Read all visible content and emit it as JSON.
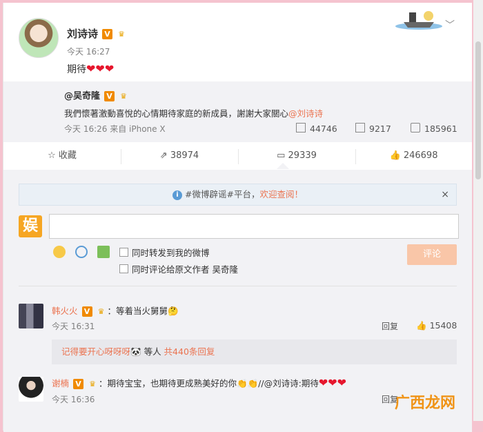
{
  "post": {
    "author": "刘诗诗",
    "verified_badge": "V",
    "time": "今天 16:27",
    "text": "期待",
    "hearts": "❤❤❤"
  },
  "repost": {
    "author": "@吴奇隆",
    "verified_badge": "V",
    "text": "我們懷著激動喜悅的心情期待家庭的新成員，謝謝大家關心",
    "mention": "@刘诗诗",
    "meta": "今天 16:26 来自 iPhone X",
    "forwards": "44746",
    "comments": "9217",
    "likes": "185961"
  },
  "actions": {
    "favorite": "收藏",
    "forward": "38974",
    "comment": "29339",
    "like": "246698"
  },
  "notice": {
    "text": "#微博辟谣#平台，",
    "link": "欢迎查阅！",
    "close": "×"
  },
  "composer": {
    "logo": "娱",
    "placeholder": "",
    "option_forward": "同时转发到我的微博",
    "option_comment": "同时评论给原文作者 吴奇隆",
    "submit": "评论"
  },
  "comments": [
    {
      "author": "韩火火",
      "text": "：等着当火舅舅",
      "time": "今天 16:31",
      "reply": "回复",
      "likes": "15408",
      "sub_replies": "记得要开心呀呀呀",
      "sub_others": " 等人 ",
      "sub_count": "共440条回复"
    },
    {
      "author": "谢楠",
      "text": "：期待宝宝，也期待更成熟美好的你",
      "repost_mention": "//@刘诗诗:",
      "repost_text": "期待",
      "time": "今天 16:36",
      "reply": "回复"
    }
  ],
  "watermark": "广西龙网",
  "colors": {
    "accent": "#eb7350",
    "badge": "#f08a00",
    "page_bg": "#f5c3cf"
  }
}
